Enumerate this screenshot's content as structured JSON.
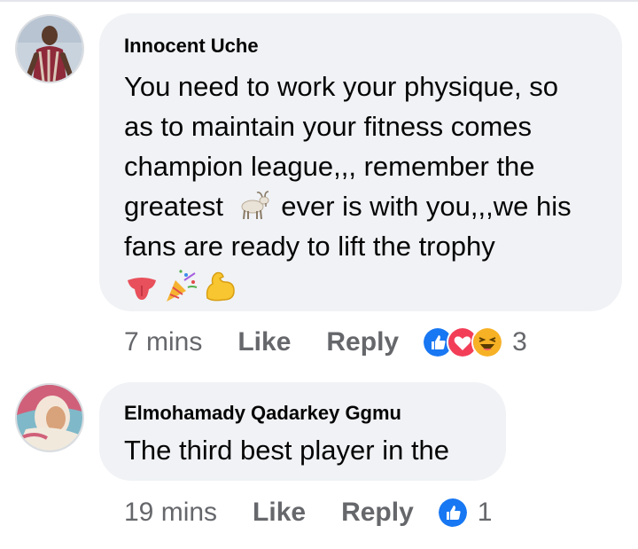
{
  "comments": [
    {
      "author": "Innocent Uche",
      "lines": [
        "You need to work your physique, so",
        "as to maintain your fitness comes",
        "champion league,,, remember the"
      ],
      "line4_before": "greatest",
      "line4_emoji": "goat-emoji",
      "line4_after": "ever is with you,,,we his",
      "line5": "fans are ready to lift the trophy",
      "trailing_emojis": [
        "tongue-emoji",
        "party-popper-emoji",
        "flexed-biceps-emoji"
      ],
      "time": "7 mins",
      "like_label": "Like",
      "reply_label": "Reply",
      "reactions": [
        "like-reaction-icon",
        "love-reaction-icon",
        "haha-reaction-icon"
      ],
      "reaction_count": "3"
    },
    {
      "author": "Elmohamady Qadarkey Ggmu",
      "text": "The third best player in the",
      "time": "19 mins",
      "like_label": "Like",
      "reply_label": "Reply",
      "reactions": [
        "like-reaction-icon"
      ],
      "reaction_count": "1"
    }
  ],
  "colors": {
    "bubble": "#f0f2f5",
    "meta_text": "#65676b",
    "like_blue": "#1877f2",
    "love_red": "#f33e58",
    "haha_yellow": "#f7b125"
  }
}
